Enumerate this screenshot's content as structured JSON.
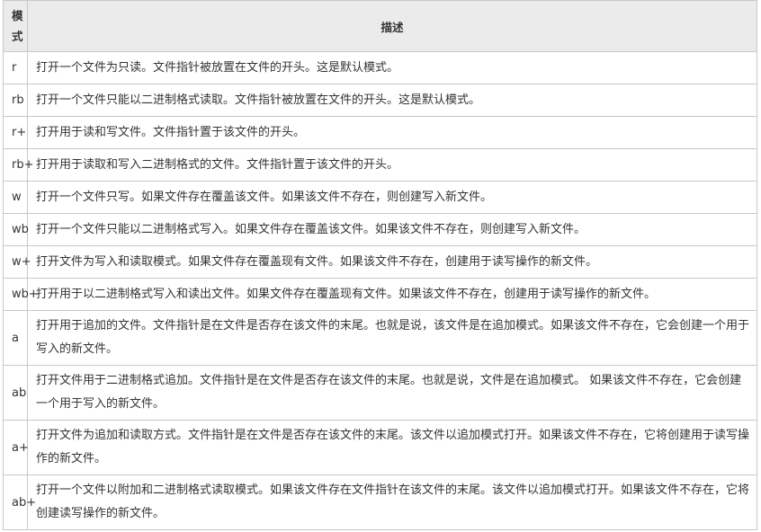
{
  "table": {
    "header": {
      "mode": "模式",
      "description": "描述"
    },
    "rows": [
      {
        "mode": "r",
        "description": "打开一个文件为只读。文件指针被放置在文件的开头。这是默认模式。"
      },
      {
        "mode": "rb",
        "description": "打开一个文件只能以二进制格式读取。文件指针被放置在文件的开头。这是默认模式。"
      },
      {
        "mode": "r+",
        "description": "打开用于读和写文件。文件指针置于该文件的开头。"
      },
      {
        "mode": "rb+",
        "description": "打开用于读取和写入二进制格式的文件。文件指针置于该文件的开头。"
      },
      {
        "mode": "w",
        "description": "打开一个文件只写。如果文件存在覆盖该文件。如果该文件不存在，则创建写入新文件。"
      },
      {
        "mode": "wb",
        "description": "打开一个文件只能以二进制格式写入。如果文件存在覆盖该文件。如果该文件不存在，则创建写入新文件。"
      },
      {
        "mode": "w+",
        "description": "打开文件为写入和读取模式。如果文件存在覆盖现有文件。如果该文件不存在，创建用于读写操作的新文件。"
      },
      {
        "mode": "wb+",
        "description": "打开用于以二进制格式写入和读出文件。如果文件存在覆盖现有文件。如果该文件不存在，创建用于读写操作的新文件。"
      },
      {
        "mode": "a",
        "description": "打开用于追加的文件。文件指针是在文件是否存在该文件的末尾。也就是说，该文件是在追加模式。如果该文件不存在，它会创建一个用于写入的新文件。"
      },
      {
        "mode": "ab",
        "description": "打开文件用于二进制格式追加。文件指针是在文件是否存在该文件的末尾。也就是说，文件是在追加模式。 如果该文件不存在，它会创建一个用于写入的新文件。"
      },
      {
        "mode": "a+",
        "description": "打开文件为追加和读取方式。文件指针是在文件是否存在该文件的末尾。该文件以追加模式打开。如果该文件不存在，它将创建用于读写操作的新文件。"
      },
      {
        "mode": "ab+",
        "description": "打开一个文件以附加和二进制格式读取模式。如果该文件存在文件指针在该文件的末尾。该文件以追加模式打开。如果该文件不存在，它将创建读写操作的新文件。"
      }
    ]
  }
}
